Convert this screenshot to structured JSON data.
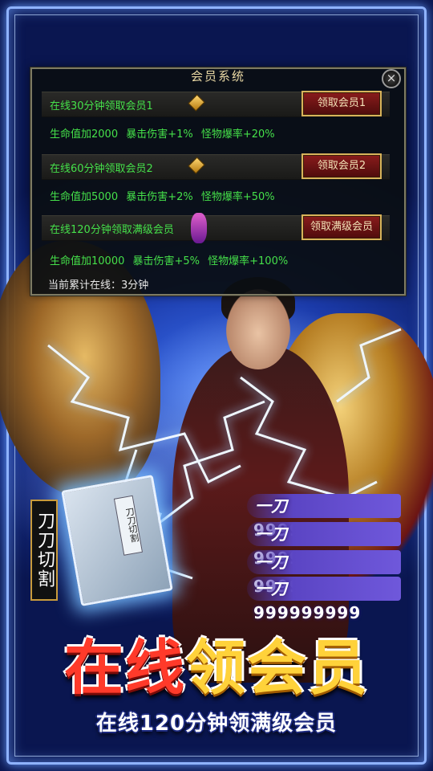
{
  "panel": {
    "title": "会员系统",
    "close_symbol": "×",
    "rows": [
      {
        "label": "在线30分钟领取会员1",
        "button": "领取会员1",
        "desc": "生命值加2000  暴击伤害+1%  怪物爆率+20%"
      },
      {
        "label": "在线60分钟领取会员2",
        "button": "领取会员2",
        "desc": "生命值加5000  暴击伤害+2%  怪物爆率+50%"
      },
      {
        "label": "在线120分钟领取满级会员",
        "button": "领取满级会员",
        "desc": "生命值加10000  暴击伤害+5%  怪物爆率+100%"
      }
    ],
    "total_online": "当前累计在线：3分钟"
  },
  "skill_book": {
    "cover_text": "刀刀切割",
    "tag_text": "刀刀切割"
  },
  "damage_lines": [
    {
      "label": "一刀",
      "value": "999999999"
    },
    {
      "label": "一刀",
      "value": "999999999"
    },
    {
      "label": "一刀",
      "value": "999999999"
    },
    {
      "label": "一刀",
      "value": "999999999"
    }
  ],
  "headline": {
    "part1": "在线",
    "part2": "领会员"
  },
  "subline": "在线120分钟领满级会员",
  "colors": {
    "green_text": "#45e04a",
    "gold": "#ffd23a",
    "red": "#ff3a2a",
    "panel_bg": "#0e1216"
  }
}
